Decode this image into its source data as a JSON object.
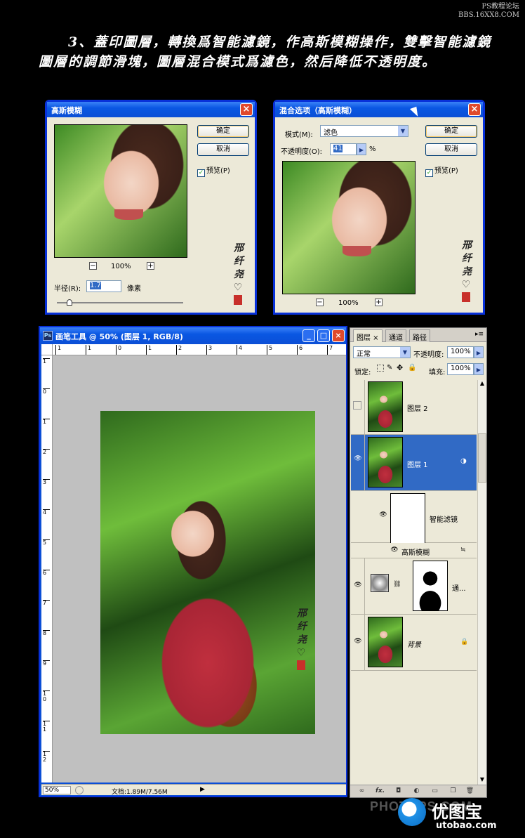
{
  "watermark_top": {
    "line1": "PS教程论坛",
    "line2": "BBS.16XX8.COM"
  },
  "heading": "3、蓋印圖層，轉換爲智能濾鏡，作高斯模糊操作，雙擊智能濾鏡圖層的調節滑塊，圖層混合模式爲濾色，然后降低不透明度。",
  "gaussian_dialog": {
    "title": "高斯模糊",
    "ok": "确定",
    "cancel": "取消",
    "preview": "预览(P)",
    "zoom": "100%",
    "radius_label": "半径(R):",
    "radius_value": "1.7",
    "radius_unit": "像素",
    "slider_level": 0.1
  },
  "blend_dialog": {
    "title": "混合选项（高斯模糊）",
    "mode_label": "模式(M):",
    "mode_value": "滤色",
    "opacity_label": "不透明度(O):",
    "opacity_value": "41",
    "opacity_unit": "%",
    "ok": "确定",
    "cancel": "取消",
    "preview": "预览(P)",
    "zoom": "100%"
  },
  "ps_window": {
    "title": "画笔工具 @ 50% (图层 1, RGB/8)",
    "ps_icon": "Ps",
    "minimize": "_",
    "maximize": "□",
    "close": "×",
    "ruler_top": [
      "1",
      "1",
      "0",
      "1",
      "2",
      "3",
      "4",
      "5",
      "6",
      "7",
      "8"
    ],
    "ruler_left": [
      "1",
      "0",
      "1",
      "2",
      "3",
      "4",
      "5",
      "6",
      "7",
      "8",
      "9",
      "1 0",
      "1 1",
      "1 2"
    ],
    "status_zoom": "50%",
    "status_doc": "文档:1.89M/7.56M"
  },
  "layers_panel": {
    "tabs": [
      "图层 ×",
      "通道",
      "路径"
    ],
    "blend_mode": "正常",
    "opacity_label": "不透明度:",
    "opacity_value": "100%",
    "lock_label": "锁定:",
    "fill_label": "填充:",
    "fill_value": "100%",
    "layers": [
      {
        "name": "图层 2",
        "visible": false
      },
      {
        "name": "图层 1",
        "visible": true,
        "selected": true
      },
      {
        "name": "智能滤镜",
        "visible": true
      },
      {
        "name": "高斯模糊",
        "visible": true
      },
      {
        "name": "通...",
        "visible": true
      },
      {
        "name": "背景",
        "visible": true
      }
    ],
    "bottom_icons": [
      "link-icon",
      "fx-icon",
      "mask-icon",
      "adjustment-icon",
      "folder-icon",
      "new-layer-icon",
      "trash-icon"
    ],
    "fx_label": "fx."
  },
  "bottom_watermark": {
    "brand": "PHOTOPS.COM",
    "site_cn": "优图宝",
    "site": "utobao.com"
  },
  "signature": "邢 纤 尧 ♡"
}
